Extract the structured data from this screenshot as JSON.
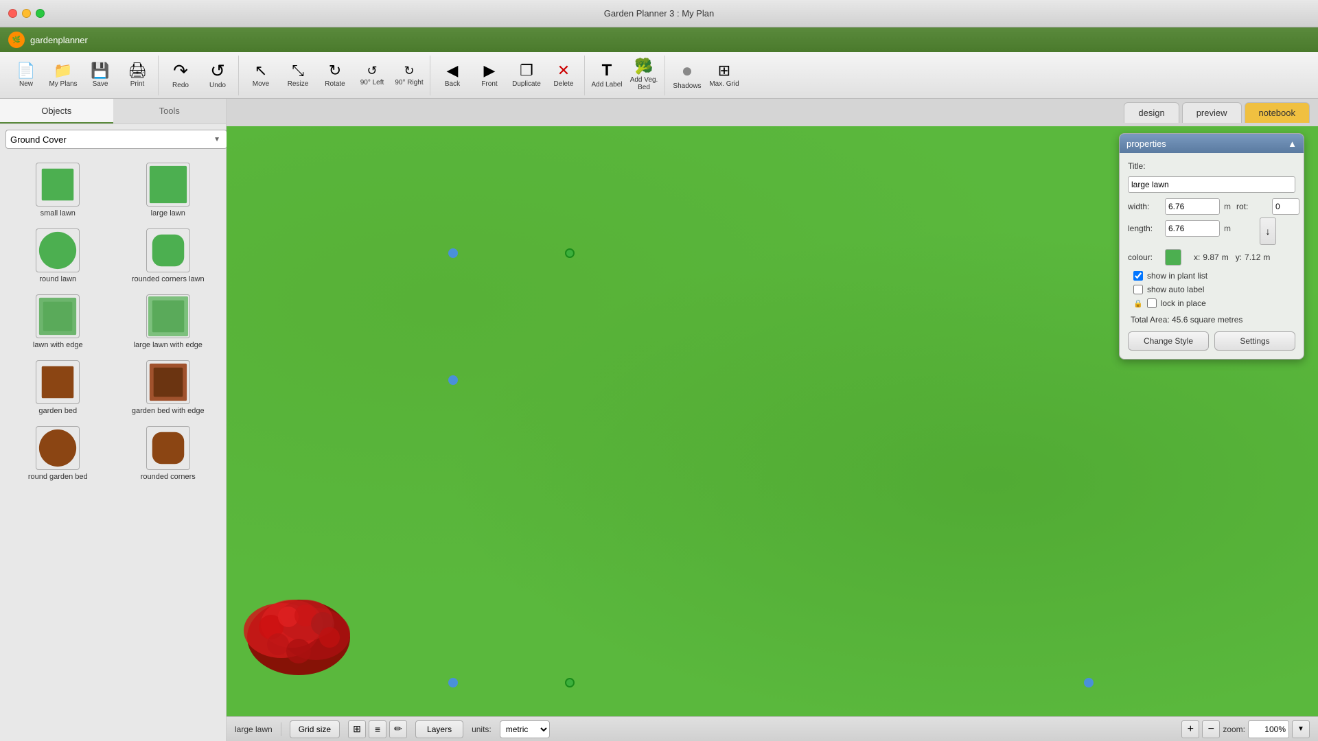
{
  "titlebar": {
    "title": "Garden Planner 3 : My  Plan"
  },
  "appheader": {
    "logo": "🌿",
    "name": "gardenplanner"
  },
  "toolbar": {
    "tools": [
      {
        "id": "new",
        "icon": "📄",
        "label": "New"
      },
      {
        "id": "my-plans",
        "icon": "📁",
        "label": "My Plans"
      },
      {
        "id": "save",
        "icon": "💾",
        "label": "Save"
      },
      {
        "id": "print",
        "icon": "🖨",
        "label": "Print"
      },
      {
        "id": "redo",
        "icon": "↷",
        "label": "Redo"
      },
      {
        "id": "undo",
        "icon": "↺",
        "label": "Undo"
      },
      {
        "id": "move",
        "icon": "↖",
        "label": "Move"
      },
      {
        "id": "resize",
        "icon": "⤡",
        "label": "Resize"
      },
      {
        "id": "rotate",
        "icon": "↻",
        "label": "Rotate"
      },
      {
        "id": "90left",
        "icon": "↺",
        "label": "90° Left"
      },
      {
        "id": "90right",
        "icon": "↻",
        "label": "90° Right"
      },
      {
        "id": "back",
        "icon": "◀",
        "label": "Back"
      },
      {
        "id": "front",
        "icon": "▶",
        "label": "Front"
      },
      {
        "id": "duplicate",
        "icon": "❐",
        "label": "Duplicate"
      },
      {
        "id": "delete",
        "icon": "✕",
        "label": "Delete"
      },
      {
        "id": "add-label",
        "icon": "T",
        "label": "Add Label"
      },
      {
        "id": "add-veg-bed",
        "icon": "🥦",
        "label": "Add Veg. Bed"
      },
      {
        "id": "shadows",
        "icon": "●",
        "label": "Shadows"
      },
      {
        "id": "max-grid",
        "icon": "⊞",
        "label": "Max. Grid"
      }
    ]
  },
  "sidebar": {
    "tabs": [
      {
        "id": "objects",
        "label": "Objects",
        "active": true
      },
      {
        "id": "tools",
        "label": "Tools",
        "active": false
      }
    ],
    "category": "Ground Cover",
    "objects": [
      {
        "id": "small-lawn",
        "label": "small lawn",
        "color": "#4caf50",
        "shape": "square"
      },
      {
        "id": "large-lawn",
        "label": "large lawn",
        "color": "#4caf50",
        "shape": "square"
      },
      {
        "id": "round-lawn",
        "label": "round lawn",
        "color": "#4caf50",
        "shape": "circle"
      },
      {
        "id": "rounded-corners-lawn",
        "label": "rounded corners lawn",
        "color": "#4caf50",
        "shape": "rounded"
      },
      {
        "id": "lawn-with-edge",
        "label": "lawn with edge",
        "color": "#6db56d",
        "shape": "square-border"
      },
      {
        "id": "large-lawn-with-edge",
        "label": "large lawn with edge",
        "color": "#5aad5a",
        "shape": "square-border"
      },
      {
        "id": "garden-bed",
        "label": "garden bed",
        "color": "#8B4513",
        "shape": "square"
      },
      {
        "id": "garden-bed-with-edge",
        "label": "garden bed with edge",
        "color": "#8B4513",
        "shape": "square-border"
      },
      {
        "id": "round-garden-bed",
        "label": "round garden bed",
        "color": "#8B4513",
        "shape": "circle"
      },
      {
        "id": "rounded-corners",
        "label": "rounded corners",
        "color": "#8B4513",
        "shape": "rounded"
      }
    ]
  },
  "viewtabs": [
    {
      "id": "design",
      "label": "design"
    },
    {
      "id": "preview",
      "label": "preview"
    },
    {
      "id": "notebook",
      "label": "notebook"
    }
  ],
  "canvas": {
    "current_item": "large lawn"
  },
  "properties": {
    "panel_title": "properties",
    "title_label": "Title:",
    "title_value": "large lawn",
    "width_label": "width:",
    "width_value": "6.76",
    "width_unit": "m",
    "length_label": "length:",
    "length_value": "6.76",
    "length_unit": "m",
    "rot_label": "rot:",
    "rot_value": "0",
    "colour_label": "colour:",
    "x_label": "x:",
    "x_value": "9.87",
    "x_unit": "m",
    "y_label": "y:",
    "y_value": "7.12",
    "y_unit": "m",
    "show_in_plant_list_label": "show in plant list",
    "show_in_plant_list_checked": true,
    "show_auto_label_label": "show auto label",
    "show_auto_label_checked": false,
    "lock_in_place_label": "lock in place",
    "lock_in_place_checked": false,
    "total_area": "Total Area: 45.6 square metres",
    "change_style_btn": "Change Style",
    "settings_btn": "Settings"
  },
  "statusbar": {
    "item_name": "large lawn",
    "grid_size_btn": "Grid size",
    "layers_btn": "Layers",
    "units_label": "units:",
    "units_value": "metric",
    "zoom_label": "zoom:",
    "zoom_value": "100%"
  }
}
